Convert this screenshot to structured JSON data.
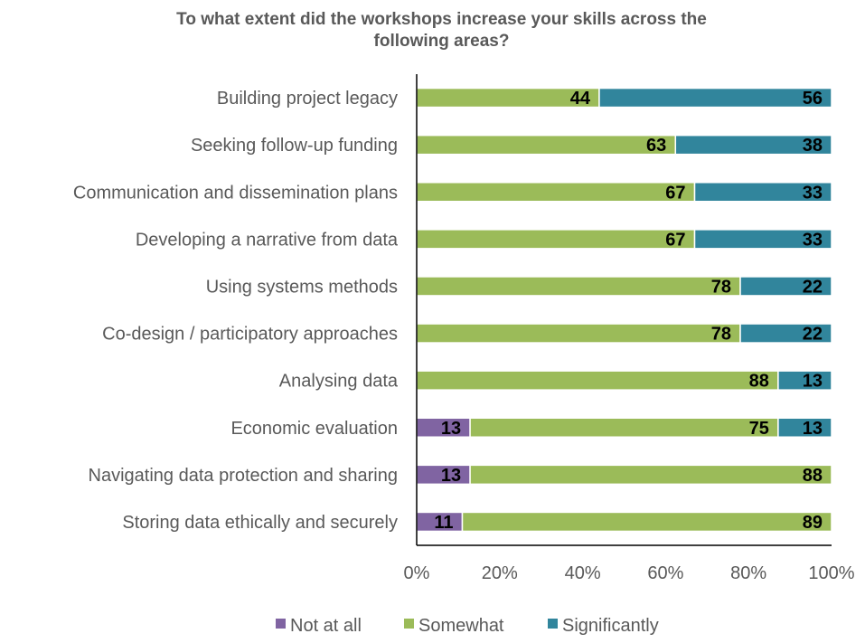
{
  "chart_data": {
    "type": "bar",
    "orientation": "horizontal",
    "stacked": "percent",
    "title": "To what extent did the workshops increase your skills across the following areas?",
    "title_lines": [
      "To what extent did the workshops increase your skills across the",
      "following areas?"
    ],
    "categories": [
      "Building project legacy",
      "Seeking follow-up funding",
      "Communication and dissemination plans",
      "Developing a narrative from data",
      "Using systems methods",
      "Co-design / participatory approaches",
      "Analysing data",
      "Economic evaluation",
      "Navigating data protection and sharing",
      "Storing data ethically and securely"
    ],
    "series": [
      {
        "name": "Not at all",
        "color": "#8064A2",
        "values": [
          0,
          0,
          0,
          0,
          0,
          0,
          0,
          13,
          13,
          11
        ]
      },
      {
        "name": "Somewhat",
        "color": "#9BBB59",
        "values": [
          44,
          63,
          67,
          67,
          78,
          78,
          88,
          75,
          88,
          89
        ]
      },
      {
        "name": "Significantly",
        "color": "#31859C",
        "values": [
          56,
          38,
          33,
          33,
          22,
          22,
          13,
          13,
          0,
          0
        ]
      }
    ],
    "xlim": [
      0,
      100
    ],
    "xticks": [
      "0%",
      "20%",
      "40%",
      "60%",
      "80%",
      "100%"
    ],
    "grid": false,
    "legend": "bottom"
  }
}
